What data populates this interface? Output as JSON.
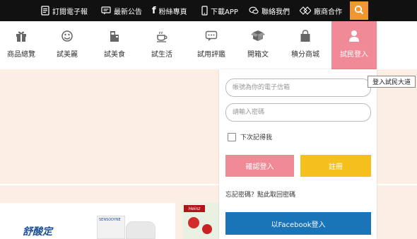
{
  "topbar": {
    "items": [
      {
        "label": "訂閱電子報",
        "icon": "newsletter-icon"
      },
      {
        "label": "最新公告",
        "icon": "announcement-icon"
      },
      {
        "label": "粉絲專頁",
        "icon": "facebook-icon"
      },
      {
        "label": "下載APP",
        "icon": "mobile-icon"
      },
      {
        "label": "聯絡我們",
        "icon": "chat-icon"
      },
      {
        "label": "廠商合作",
        "icon": "handshake-icon"
      }
    ],
    "search_icon": "search-icon",
    "bg_color": "#111111",
    "search_color": "#f29630"
  },
  "nav": {
    "items": [
      {
        "label": "商品總覽",
        "icon": "gift-icon"
      },
      {
        "label": "試美麗",
        "icon": "beauty-icon"
      },
      {
        "label": "試美食",
        "icon": "food-icon"
      },
      {
        "label": "試生活",
        "icon": "coffee-icon"
      },
      {
        "label": "試用評鑑",
        "icon": "comment-icon"
      },
      {
        "label": "開箱文",
        "icon": "box-icon"
      },
      {
        "label": "積分商城",
        "icon": "shopping-bag-icon"
      },
      {
        "label": "試民登入",
        "icon": "user-icon"
      }
    ],
    "active_color": "#f08a96"
  },
  "tooltip": "登入試民大道",
  "login": {
    "email_placeholder": "帳號為你的電子信箱",
    "password_placeholder": "請輸入密碼",
    "remember_label": "下次記得我",
    "login_button": "確認登入",
    "register_button": "註冊",
    "forgot_text": "忘記密碼？點此取回密碼",
    "facebook_button": "以Facebook登入",
    "login_color": "#f08a96",
    "register_color": "#f5c01d",
    "facebook_color": "#1a74b8"
  },
  "products": {
    "brand1": "舒酸定",
    "brand2": "SENSODYNE",
    "brand3": "Heinz"
  }
}
